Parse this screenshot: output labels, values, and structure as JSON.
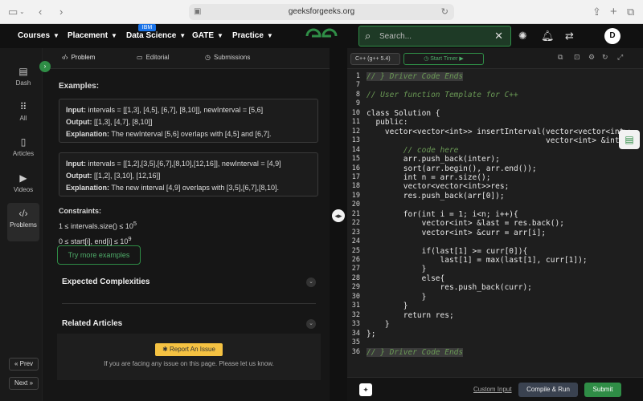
{
  "browser": {
    "url": "geeksforgeeks.org"
  },
  "nav": {
    "items": [
      "Courses",
      "Placement",
      "Data Science",
      "GATE",
      "Practice"
    ],
    "ibm_badge": "IBM",
    "search_placeholder": "Search...",
    "avatar_letter": "D"
  },
  "sidebar": {
    "items": [
      "Dash",
      "All",
      "Articles",
      "Videos",
      "Problems"
    ],
    "prev": "Prev",
    "next": "Next"
  },
  "problem": {
    "tabs": [
      "Problem",
      "Editorial",
      "Submissions"
    ],
    "examples_title": "Examples:",
    "example1": {
      "input_label": "Input:",
      "input": "intervals = [[1,3], [4,5], [6,7], [8,10]], newInterval = [5,6]",
      "output_label": "Output:",
      "output": "[[1,3], [4,7], [8,10]]",
      "explanation_label": "Explanation:",
      "explanation": "The newInterval [5,6] overlaps with [4,5] and [6,7]."
    },
    "example2": {
      "input_label": "Input:",
      "input": "intervals = [[1,2],[3,5],[6,7],[8,10],[12,16]], newInterval = [4,9]",
      "output_label": "Output:",
      "output": "[[1,2], [3,10], [12,16]]",
      "explanation_label": "Explanation:",
      "explanation": "The new interval [4,9] overlaps with [3,5],[6,7],[8,10]."
    },
    "constraints_title": "Constraints:",
    "constraint1": "1 ≤ intervals.size() ≤ 10",
    "constraint1_exp": "5",
    "constraint2": "0 ≤ start[i], end[i] ≤ 10",
    "constraint2_exp": "9",
    "try_more": "Try more examples",
    "expected_complexities": "Expected Complexities",
    "related_articles": "Related Articles",
    "report_btn": "Report An Issue",
    "report_note": "If you are facing any issue on this page. Please let us know."
  },
  "editor": {
    "language": "C++ (g++ 5.4)",
    "start_timer": "Start Timer",
    "custom_input": "Custom Input",
    "compile_run": "Compile & Run",
    "submit": "Submit",
    "lines": [
      {
        "n": "1",
        "t": "// } Driver Code Ends",
        "k": "hl"
      },
      {
        "n": "7",
        "t": "",
        "k": ""
      },
      {
        "n": "8",
        "t": "// User function Template for C++",
        "k": "cm"
      },
      {
        "n": "9",
        "t": "",
        "k": ""
      },
      {
        "n": "10",
        "t": "class Solution {",
        "k": ""
      },
      {
        "n": "11",
        "t": "  public:",
        "k": ""
      },
      {
        "n": "12",
        "t": "    vector<vector<int>> insertInterval(vector<vector<int>>",
        "k": ""
      },
      {
        "n": "13",
        "t": "                                       vector<int> &inter)",
        "k": ""
      },
      {
        "n": "14",
        "t": "        // code here",
        "k": "cm"
      },
      {
        "n": "15",
        "t": "        arr.push_back(inter);",
        "k": ""
      },
      {
        "n": "16",
        "t": "        sort(arr.begin(), arr.end());",
        "k": ""
      },
      {
        "n": "17",
        "t": "        int n = arr.size();",
        "k": ""
      },
      {
        "n": "18",
        "t": "        vector<vector<int>>res;",
        "k": ""
      },
      {
        "n": "19",
        "t": "        res.push_back(arr[0]);",
        "k": ""
      },
      {
        "n": "20",
        "t": "",
        "k": ""
      },
      {
        "n": "21",
        "t": "        for(int i = 1; i<n; i++){",
        "k": ""
      },
      {
        "n": "22",
        "t": "            vector<int> &last = res.back();",
        "k": ""
      },
      {
        "n": "23",
        "t": "            vector<int> &curr = arr[i];",
        "k": ""
      },
      {
        "n": "24",
        "t": "",
        "k": ""
      },
      {
        "n": "25",
        "t": "            if(last[1] >= curr[0]){",
        "k": ""
      },
      {
        "n": "26",
        "t": "                last[1] = max(last[1], curr[1]);",
        "k": ""
      },
      {
        "n": "27",
        "t": "            }",
        "k": ""
      },
      {
        "n": "28",
        "t": "            else{",
        "k": ""
      },
      {
        "n": "29",
        "t": "                res.push_back(curr);",
        "k": ""
      },
      {
        "n": "30",
        "t": "            }",
        "k": ""
      },
      {
        "n": "31",
        "t": "        }",
        "k": ""
      },
      {
        "n": "32",
        "t": "        return res;",
        "k": ""
      },
      {
        "n": "33",
        "t": "    }",
        "k": ""
      },
      {
        "n": "34",
        "t": "};",
        "k": ""
      },
      {
        "n": "35",
        "t": "",
        "k": ""
      },
      {
        "n": "36",
        "t": "// } Driver Code Ends",
        "k": "hl"
      }
    ]
  },
  "colors": {
    "brand_green": "#2f8d46",
    "report_yellow": "#f5c242"
  }
}
